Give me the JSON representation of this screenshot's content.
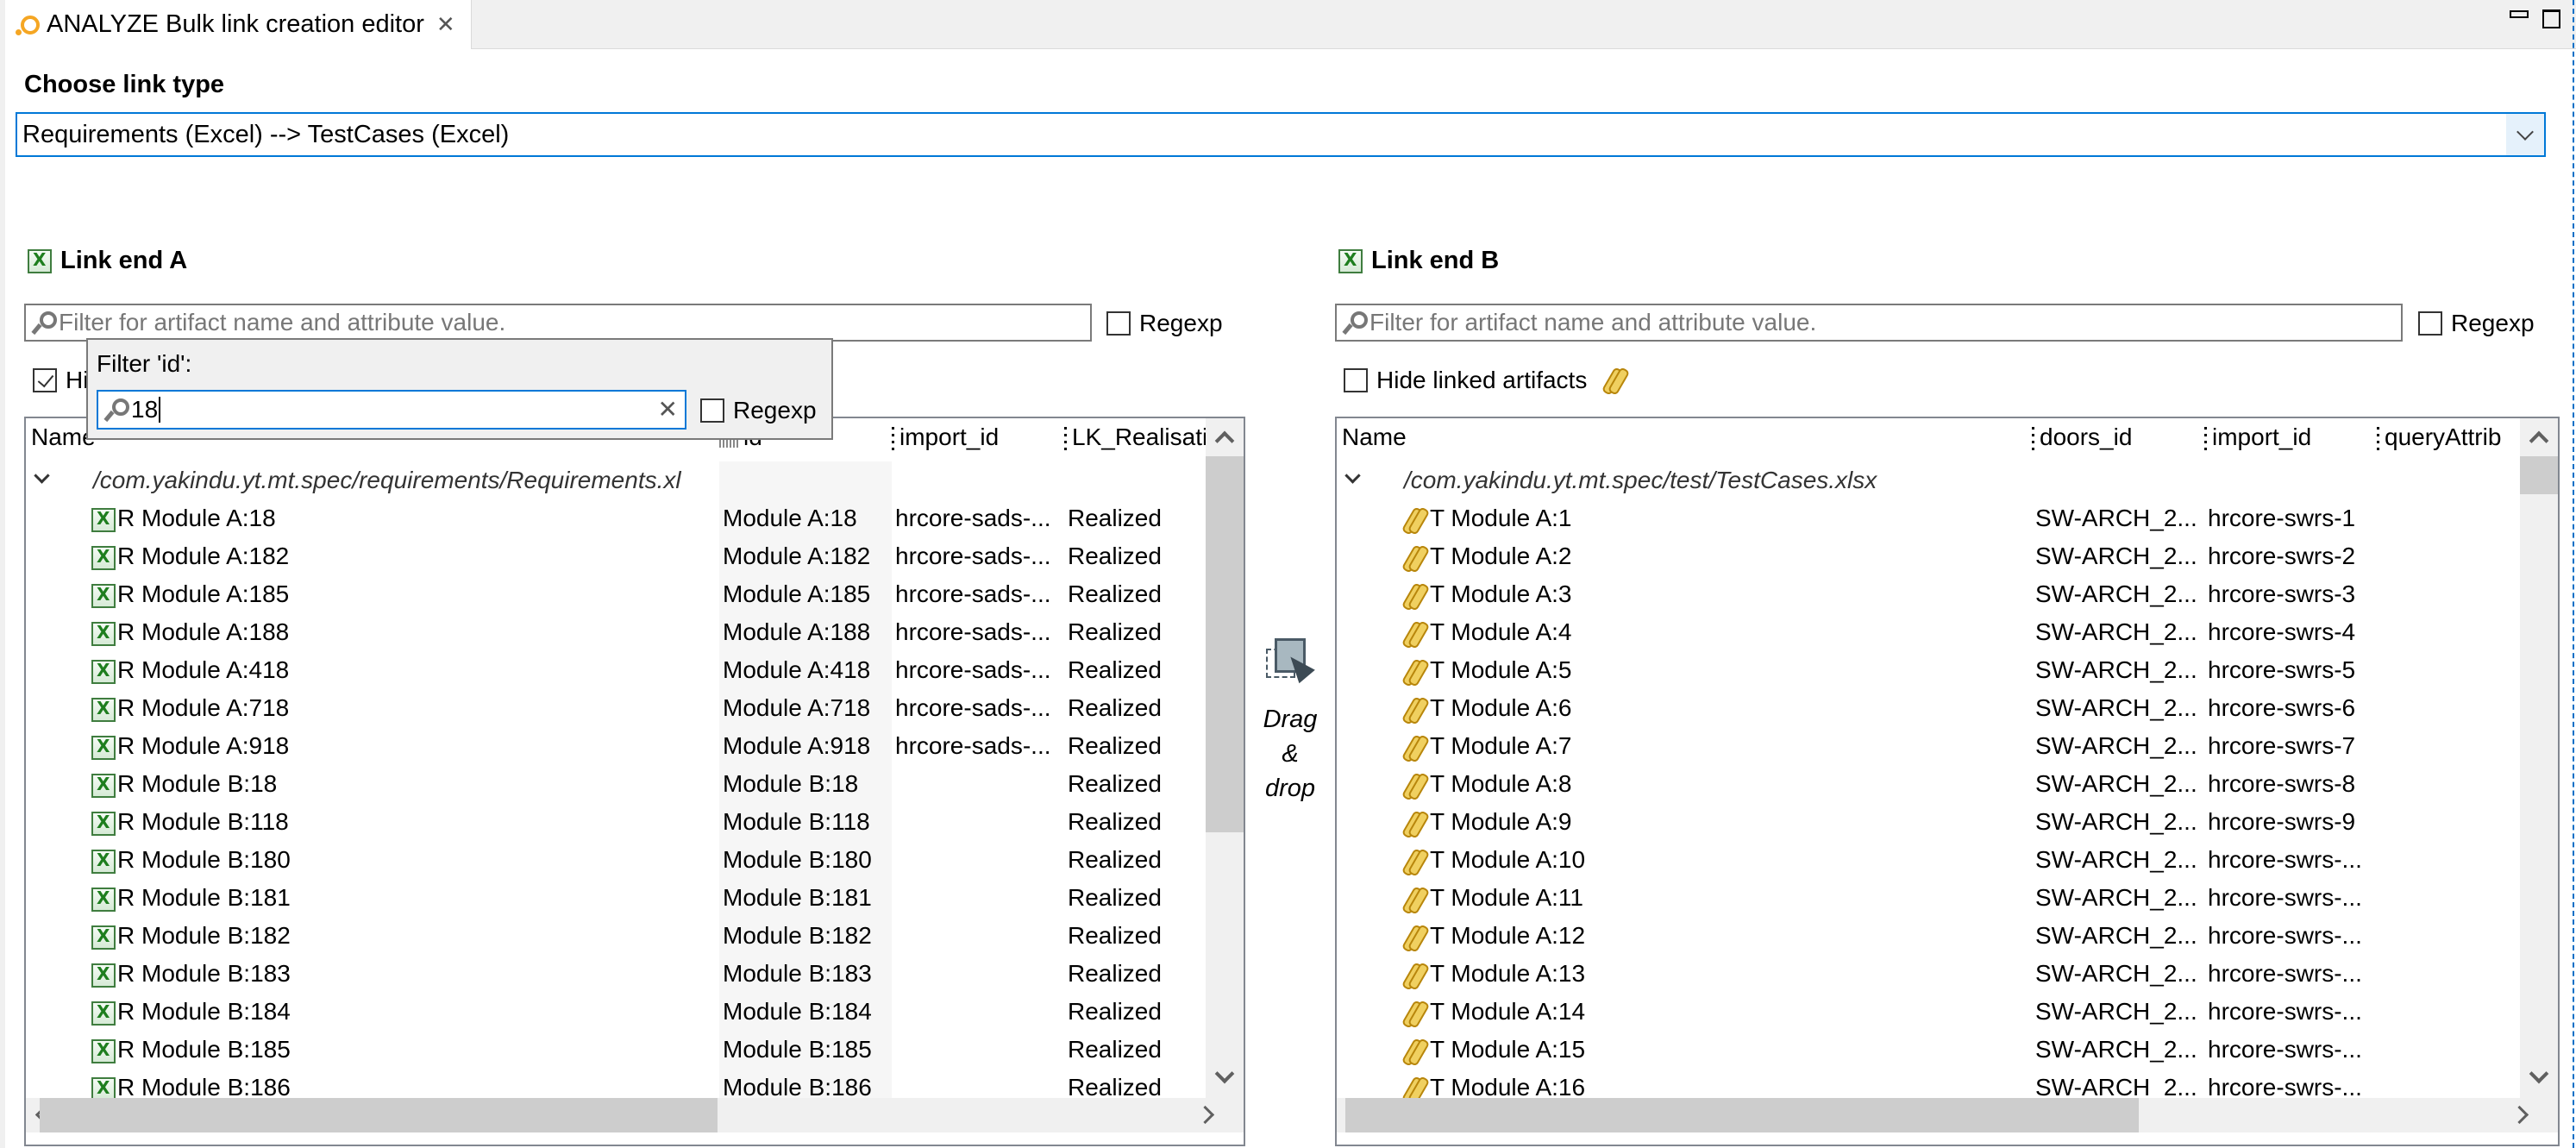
{
  "window": {
    "tab_title": "ANALYZE Bulk link creation editor",
    "tab_icon": "analyze-icon",
    "minimize_icon": "minimize-icon",
    "maximize_icon": "maximize-icon"
  },
  "link_type": {
    "label": "Choose link type",
    "selected": "Requirements (Excel) --> TestCases (Excel)"
  },
  "end_a": {
    "label": "Link end A",
    "filter_placeholder": "Filter for artifact name and attribute value.",
    "regexp_label": "Regexp",
    "regexp_checked": false,
    "hide_linked_label": "Hide linked artifacts",
    "hide_linked_checked": true,
    "columns": [
      "Name",
      "id",
      "import_id",
      "LK_Realisati"
    ],
    "group": "/com.yakindu.yt.mt.spec/requirements/Requirements.xl",
    "rows": [
      {
        "name": "R Module A:18",
        "id": "Module A:18",
        "import_id": "hrcore-sads-...",
        "lk": "Realized"
      },
      {
        "name": "R Module A:182",
        "id": "Module A:182",
        "import_id": "hrcore-sads-...",
        "lk": "Realized"
      },
      {
        "name": "R Module A:185",
        "id": "Module A:185",
        "import_id": "hrcore-sads-...",
        "lk": "Realized"
      },
      {
        "name": "R Module A:188",
        "id": "Module A:188",
        "import_id": "hrcore-sads-...",
        "lk": "Realized"
      },
      {
        "name": "R Module A:418",
        "id": "Module A:418",
        "import_id": "hrcore-sads-...",
        "lk": "Realized"
      },
      {
        "name": "R Module A:718",
        "id": "Module A:718",
        "import_id": "hrcore-sads-...",
        "lk": "Realized"
      },
      {
        "name": "R Module A:918",
        "id": "Module A:918",
        "import_id": "hrcore-sads-...",
        "lk": "Realized"
      },
      {
        "name": "R Module B:18",
        "id": "Module B:18",
        "import_id": "",
        "lk": "Realized"
      },
      {
        "name": "R Module B:118",
        "id": "Module B:118",
        "import_id": "",
        "lk": "Realized"
      },
      {
        "name": "R Module B:180",
        "id": "Module B:180",
        "import_id": "",
        "lk": "Realized"
      },
      {
        "name": "R Module B:181",
        "id": "Module B:181",
        "import_id": "",
        "lk": "Realized"
      },
      {
        "name": "R Module B:182",
        "id": "Module B:182",
        "import_id": "",
        "lk": "Realized"
      },
      {
        "name": "R Module B:183",
        "id": "Module B:183",
        "import_id": "",
        "lk": "Realized"
      },
      {
        "name": "R Module B:184",
        "id": "Module B:184",
        "import_id": "",
        "lk": "Realized"
      },
      {
        "name": "R Module B:185",
        "id": "Module B:185",
        "import_id": "",
        "lk": "Realized"
      },
      {
        "name": "R Module B:186",
        "id": "Module B:186",
        "import_id": "",
        "lk": "Realized"
      }
    ],
    "column_filter_popup": {
      "label": "Filter 'id':",
      "value": "18",
      "regexp_label": "Regexp",
      "regexp_checked": false
    }
  },
  "drag_drop": {
    "line1": "Drag",
    "line2": "&",
    "line3": "drop"
  },
  "end_b": {
    "label": "Link end B",
    "filter_placeholder": "Filter for artifact name and attribute value.",
    "regexp_label": "Regexp",
    "regexp_checked": false,
    "hide_linked_label": "Hide linked artifacts",
    "hide_linked_checked": false,
    "columns": [
      "Name",
      "doors_id",
      "import_id",
      "queryAttrib"
    ],
    "group": "/com.yakindu.yt.mt.spec/test/TestCases.xlsx",
    "rows": [
      {
        "name": "T Module A:1",
        "doors_id": "SW-ARCH_2...",
        "import_id": "hrcore-swrs-1"
      },
      {
        "name": "T Module A:2",
        "doors_id": "SW-ARCH_2...",
        "import_id": "hrcore-swrs-2"
      },
      {
        "name": "T Module A:3",
        "doors_id": "SW-ARCH_2...",
        "import_id": "hrcore-swrs-3"
      },
      {
        "name": "T Module A:4",
        "doors_id": "SW-ARCH_2...",
        "import_id": "hrcore-swrs-4"
      },
      {
        "name": "T Module A:5",
        "doors_id": "SW-ARCH_2...",
        "import_id": "hrcore-swrs-5"
      },
      {
        "name": "T Module A:6",
        "doors_id": "SW-ARCH_2...",
        "import_id": "hrcore-swrs-6"
      },
      {
        "name": "T Module A:7",
        "doors_id": "SW-ARCH_2...",
        "import_id": "hrcore-swrs-7"
      },
      {
        "name": "T Module A:8",
        "doors_id": "SW-ARCH_2...",
        "import_id": "hrcore-swrs-8"
      },
      {
        "name": "T Module A:9",
        "doors_id": "SW-ARCH_2...",
        "import_id": "hrcore-swrs-9"
      },
      {
        "name": "T Module A:10",
        "doors_id": "SW-ARCH_2...",
        "import_id": "hrcore-swrs-..."
      },
      {
        "name": "T Module A:11",
        "doors_id": "SW-ARCH_2...",
        "import_id": "hrcore-swrs-..."
      },
      {
        "name": "T Module A:12",
        "doors_id": "SW-ARCH_2...",
        "import_id": "hrcore-swrs-..."
      },
      {
        "name": "T Module A:13",
        "doors_id": "SW-ARCH_2...",
        "import_id": "hrcore-swrs-..."
      },
      {
        "name": "T Module A:14",
        "doors_id": "SW-ARCH_2...",
        "import_id": "hrcore-swrs-..."
      },
      {
        "name": "T Module A:15",
        "doors_id": "SW-ARCH_2...",
        "import_id": "hrcore-swrs-..."
      },
      {
        "name": "T Module A:16",
        "doors_id": "SW-ARCH_2...",
        "import_id": "hrcore-swrs-..."
      }
    ]
  },
  "colors": {
    "accent": "#0078d7",
    "excel_green": "#1e7e1e",
    "link_gold": "#b8860b",
    "tab_icon": "#f5a623"
  }
}
